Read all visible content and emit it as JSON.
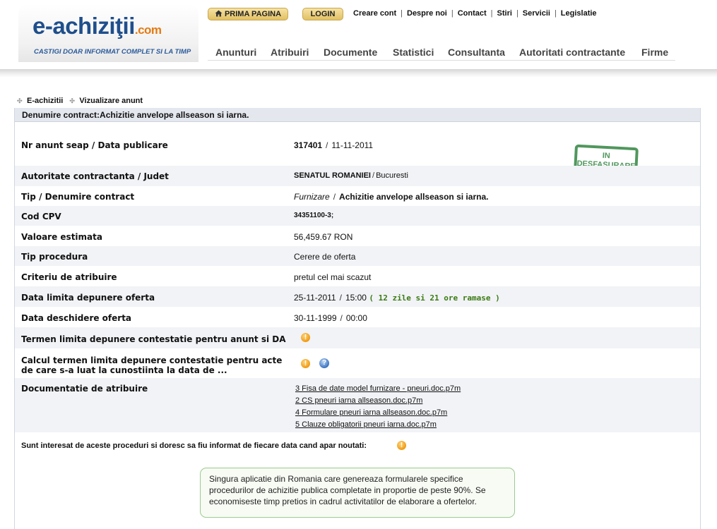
{
  "header": {
    "logo": {
      "main": "e-achiziţii",
      "suffix": ".com",
      "tagline": "CASTIGI DOAR INFORMAT COMPLET SI LA TIMP"
    },
    "buttons": {
      "home": "PRIMA PAGINA",
      "login": "LOGIN"
    },
    "top_links": [
      "Creare cont",
      "Despre noi",
      "Contact",
      "Stiri",
      "Servicii",
      "Legislatie"
    ],
    "nav": [
      "Anunturi",
      "Atribuiri",
      "Documente",
      "Statistici",
      "Consultanta",
      "Autoritati contractante",
      "Firme"
    ]
  },
  "breadcrumb": [
    "E-achizitii",
    "Vizualizare anunt"
  ],
  "title": "Denumire contract:Achizitie anvelope allseason si iarna.",
  "stamp": {
    "line1": "IN",
    "line2": "DESFASURARE",
    "color": "#3e8c4c"
  },
  "fields": {
    "nr_anunt": {
      "label": "Nr anunt seap / Data publicare",
      "number": "317401",
      "date": "11-11-2011"
    },
    "autoritate": {
      "label": "Autoritate contractanta / Judet",
      "name": "SENATUL ROMANIEI",
      "judet": "Bucuresti"
    },
    "tip": {
      "label": "Tip / Denumire contract",
      "type": "Furnizare",
      "name": "Achizitie anvelope allseason si iarna."
    },
    "cpv": {
      "label": "Cod CPV",
      "value": "34351100-3;"
    },
    "valoare": {
      "label": "Valoare estimata",
      "value": "56,459.67 RON"
    },
    "procedura": {
      "label": "Tip procedura",
      "value": "Cerere de oferta"
    },
    "criteriu": {
      "label": "Criteriu de atribuire",
      "value": "pretul cel mai scazut"
    },
    "limita": {
      "label": "Data limita depunere oferta",
      "date": "25-11-2011",
      "time": "15:00",
      "remaining": "( 12 zile si 21 ore ramase )"
    },
    "deschidere": {
      "label": "Data deschidere oferta",
      "date": "30-11-1999",
      "time": "00:00"
    },
    "contestatie": {
      "label": "Termen limita depunere contestatie pentru anunt si DA"
    },
    "calcul": {
      "label": "Calcul termen limita depunere contestatie pentru acte de care s-a luat la cunostiinta la data de ..."
    },
    "documentatie": {
      "label": "Documentatie de atribuire",
      "files": [
        "3 Fisa de date  model furnizare - pneuri.doc.p7m",
        "2 CS pneuri iarna allseason.doc.p7m",
        "4 Formulare pneuri iarna allseason.doc.p7m",
        "5 Clauze obligatorii pneuri iarna.doc.p7m"
      ]
    }
  },
  "separator": "/",
  "info_glyph": "!",
  "help_glyph": "?",
  "notify_text": "Sunt interesat de aceste proceduri si doresc sa fiu informat de fiecare data cand apar noutati:",
  "promo_text": "Singura aplicatie din Romania care genereaza formularele specifice procedurilor de achizitie publica completate in proportie de peste 90%. Se economiseste timp pretios in cadrul activitatilor de elaborare a ofertelor."
}
